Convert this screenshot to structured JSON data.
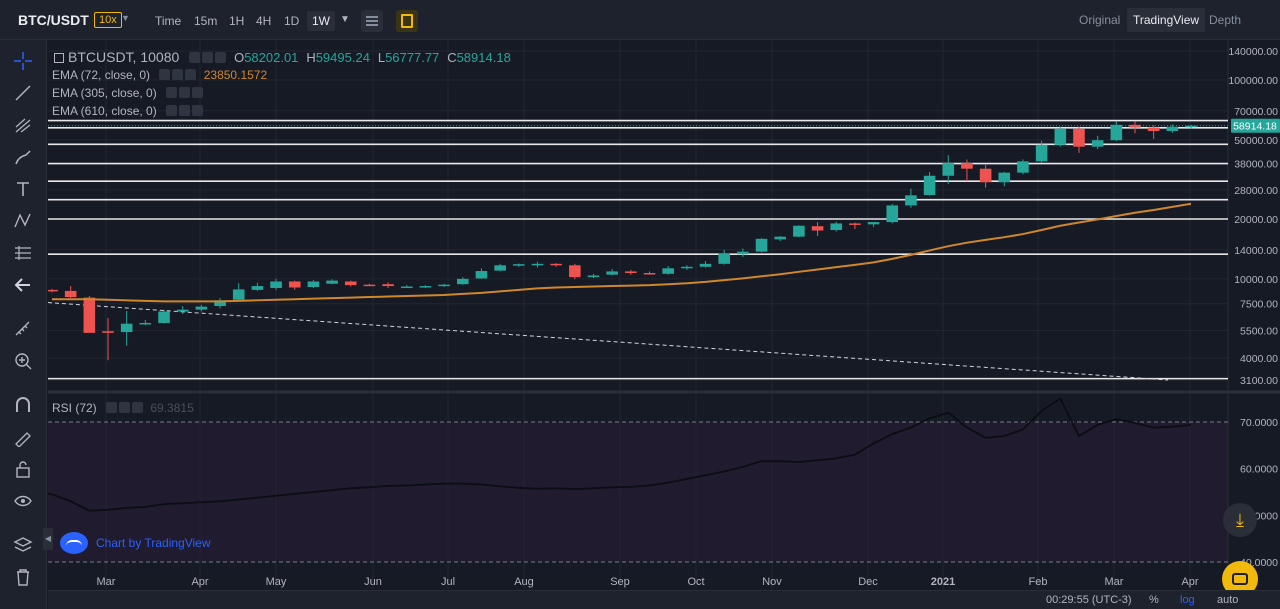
{
  "header": {
    "pair": "BTC/USDT",
    "leverage": "10x",
    "timeframes": [
      {
        "label": "Time",
        "x": 0
      },
      {
        "label": "15m"
      },
      {
        "label": "1H"
      },
      {
        "label": "4H"
      },
      {
        "label": "1D"
      },
      {
        "label": "1W"
      }
    ],
    "views": [
      "Original",
      "TradingView",
      "Depth"
    ]
  },
  "legend": {
    "symbol": "BTCUSDT, 10080",
    "o_label": "O",
    "open": "58202.01",
    "h_label": "H",
    "high": "59495.24",
    "l_label": "L",
    "low": "56777.77",
    "c_label": "C",
    "close": "58914.18",
    "ema1": "EMA (72, close, 0)",
    "ema1_value": "23850.1572",
    "ema2": "EMA (305, close, 0)",
    "ema3": "EMA (610, close, 0)",
    "rsi": "RSI (72)",
    "rsi_value": "69.3815"
  },
  "watermark": "Chart by TradingView",
  "footer": {
    "time": "00:29:55 (UTC-3)",
    "percent": "%",
    "log": "log",
    "auto": "auto"
  },
  "icons": [
    "crosshair-icon",
    "trend-line-icon",
    "pitchfork-icon",
    "brush-icon",
    "text-icon",
    "pattern-icon",
    "measure-icon",
    "back-arrow-icon",
    "ruler-icon",
    "zoom-icon",
    "magnet-icon",
    "lock-drawing-icon",
    "lock-icon",
    "eye-icon",
    "layers-icon",
    "trash-icon"
  ],
  "colors": {
    "up": "#26a69a",
    "down": "#ef5350",
    "ema": "#d0862b",
    "accent": "#f0b90b",
    "link": "#2962ff"
  },
  "chart_data": {
    "type": "candlestick",
    "price_axis": {
      "scale": "log",
      "ticks": [
        "140000.00",
        "100000.00",
        "70000.00",
        "50000.00",
        "38000.00",
        "28000.00",
        "20000.00",
        "14000.00",
        "10000.00",
        "7500.00",
        "5500.00",
        "4000.00",
        "3100.00"
      ],
      "last_price_label": "58914.18"
    },
    "time_axis": {
      "ticks": [
        "Mar",
        "Apr",
        "May",
        "Jun",
        "Jul",
        "Aug",
        "Sep",
        "Oct",
        "Nov",
        "Dec",
        "2021",
        "Feb",
        "Mar",
        "Apr"
      ]
    },
    "horizontal_levels": [
      62500,
      57500,
      47500,
      38000,
      31000,
      25000,
      20000,
      13300,
      3150
    ],
    "candles": [
      {
        "o": 8800,
        "h": 8900,
        "l": 8550,
        "c": 8750
      },
      {
        "o": 8700,
        "h": 9200,
        "l": 8000,
        "c": 8100
      },
      {
        "o": 8050,
        "h": 8200,
        "l": 5600,
        "c": 5350
      },
      {
        "o": 5450,
        "h": 6350,
        "l": 3900,
        "c": 5350
      },
      {
        "o": 5400,
        "h": 6900,
        "l": 4600,
        "c": 5950
      },
      {
        "o": 5900,
        "h": 6200,
        "l": 5850,
        "c": 6000
      },
      {
        "o": 6000,
        "h": 7000,
        "l": 5950,
        "c": 6850
      },
      {
        "o": 6850,
        "h": 7300,
        "l": 6650,
        "c": 7000
      },
      {
        "o": 7000,
        "h": 7400,
        "l": 6850,
        "c": 7250
      },
      {
        "o": 7300,
        "h": 8000,
        "l": 7100,
        "c": 7800
      },
      {
        "o": 7850,
        "h": 9500,
        "l": 7750,
        "c": 8850
      },
      {
        "o": 8800,
        "h": 9550,
        "l": 8700,
        "c": 9200
      },
      {
        "o": 9000,
        "h": 10000,
        "l": 8800,
        "c": 9700
      },
      {
        "o": 9700,
        "h": 9800,
        "l": 8800,
        "c": 9050
      },
      {
        "o": 9100,
        "h": 9850,
        "l": 9000,
        "c": 9700
      },
      {
        "o": 9450,
        "h": 9950,
        "l": 9400,
        "c": 9800
      },
      {
        "o": 9700,
        "h": 9800,
        "l": 9150,
        "c": 9300
      },
      {
        "o": 9350,
        "h": 9450,
        "l": 9200,
        "c": 9250
      },
      {
        "o": 9400,
        "h": 9600,
        "l": 9000,
        "c": 9200
      },
      {
        "o": 9150,
        "h": 9300,
        "l": 9050,
        "c": 9150
      },
      {
        "o": 9100,
        "h": 9300,
        "l": 9000,
        "c": 9200
      },
      {
        "o": 9200,
        "h": 9450,
        "l": 9100,
        "c": 9350
      },
      {
        "o": 9400,
        "h": 10200,
        "l": 9350,
        "c": 10000
      },
      {
        "o": 10050,
        "h": 11300,
        "l": 10000,
        "c": 10950
      },
      {
        "o": 11000,
        "h": 11900,
        "l": 10900,
        "c": 11700
      },
      {
        "o": 11700,
        "h": 11950,
        "l": 11500,
        "c": 11850
      },
      {
        "o": 11800,
        "h": 12200,
        "l": 11400,
        "c": 11900
      },
      {
        "o": 11900,
        "h": 12000,
        "l": 11500,
        "c": 11700
      },
      {
        "o": 11700,
        "h": 11900,
        "l": 9950,
        "c": 10200
      },
      {
        "o": 10200,
        "h": 10600,
        "l": 10100,
        "c": 10400
      },
      {
        "o": 10500,
        "h": 11200,
        "l": 10400,
        "c": 10900
      },
      {
        "o": 10900,
        "h": 11100,
        "l": 10500,
        "c": 10700
      },
      {
        "o": 10700,
        "h": 10900,
        "l": 10500,
        "c": 10600
      },
      {
        "o": 10600,
        "h": 11600,
        "l": 10500,
        "c": 11300
      },
      {
        "o": 11300,
        "h": 11700,
        "l": 11100,
        "c": 11500
      },
      {
        "o": 11500,
        "h": 12300,
        "l": 11400,
        "c": 11900
      },
      {
        "o": 11900,
        "h": 14000,
        "l": 11800,
        "c": 13400
      },
      {
        "o": 13300,
        "h": 14200,
        "l": 12900,
        "c": 13700
      },
      {
        "o": 13700,
        "h": 16000,
        "l": 13600,
        "c": 15900
      },
      {
        "o": 15800,
        "h": 16400,
        "l": 15500,
        "c": 16300
      },
      {
        "o": 16300,
        "h": 18600,
        "l": 16200,
        "c": 18500
      },
      {
        "o": 18400,
        "h": 19300,
        "l": 16400,
        "c": 17500
      },
      {
        "o": 17600,
        "h": 19400,
        "l": 17300,
        "c": 19000
      },
      {
        "o": 19000,
        "h": 19200,
        "l": 17800,
        "c": 18800
      },
      {
        "o": 18800,
        "h": 19100,
        "l": 18200,
        "c": 19300
      },
      {
        "o": 19300,
        "h": 23800,
        "l": 19000,
        "c": 23400
      },
      {
        "o": 23400,
        "h": 28400,
        "l": 22800,
        "c": 26300
      },
      {
        "o": 26400,
        "h": 34500,
        "l": 26200,
        "c": 33000
      },
      {
        "o": 33000,
        "h": 41800,
        "l": 30000,
        "c": 38200
      },
      {
        "o": 38200,
        "h": 39800,
        "l": 31000,
        "c": 35800
      },
      {
        "o": 35800,
        "h": 37400,
        "l": 28800,
        "c": 30600
      },
      {
        "o": 30600,
        "h": 34500,
        "l": 29200,
        "c": 34200
      },
      {
        "o": 34200,
        "h": 39900,
        "l": 33500,
        "c": 39000
      },
      {
        "o": 39000,
        "h": 49500,
        "l": 38500,
        "c": 47200
      },
      {
        "o": 47200,
        "h": 58300,
        "l": 46200,
        "c": 56800
      },
      {
        "o": 56800,
        "h": 58300,
        "l": 43000,
        "c": 46200
      },
      {
        "o": 46200,
        "h": 52400,
        "l": 44900,
        "c": 49800
      },
      {
        "o": 49800,
        "h": 61800,
        "l": 49200,
        "c": 59500
      },
      {
        "o": 59500,
        "h": 61700,
        "l": 53900,
        "c": 57700
      },
      {
        "o": 57700,
        "h": 59200,
        "l": 50500,
        "c": 55400
      },
      {
        "o": 55400,
        "h": 59800,
        "l": 54100,
        "c": 58200
      },
      {
        "o": 58202.01,
        "h": 59495.24,
        "l": 56777.77,
        "c": 58914.18
      }
    ],
    "ema72": [
      7900,
      7900,
      7900,
      7850,
      7800,
      7750,
      7700,
      7700,
      7700,
      7700,
      7750,
      7800,
      7850,
      7900,
      7950,
      8000,
      8050,
      8100,
      8150,
      8200,
      8250,
      8300,
      8400,
      8500,
      8650,
      8800,
      8950,
      9050,
      9100,
      9150,
      9200,
      9250,
      9300,
      9400,
      9500,
      9650,
      9850,
      10050,
      10300,
      10550,
      10850,
      11150,
      11450,
      11750,
      12100,
      12600,
      13200,
      13900,
      14600,
      15200,
      15700,
      16200,
      16800,
      17600,
      18500,
      19200,
      19900,
      20700,
      21500,
      22200,
      23000,
      23850.1572
    ],
    "dashed_trend": {
      "from": 7600,
      "to": 3100
    },
    "rsi": {
      "ticks": [
        "70.0000",
        "60.0000",
        "50.0000",
        "40.0000"
      ],
      "overbought": 70,
      "oversold": 40,
      "values": [
        54.8,
        54.5,
        53.0,
        51.0,
        51.2,
        51.6,
        51.8,
        52.4,
        52.6,
        52.8,
        53.0,
        53.4,
        53.8,
        54.2,
        54.6,
        55.0,
        55.4,
        55.8,
        56.0,
        56.3,
        56.4,
        56.6,
        56.8,
        56.8,
        56.6,
        56.2,
        55.9,
        55.7,
        55.8,
        55.6,
        55.8,
        56.0,
        56.1,
        56.4,
        57.0,
        57.8,
        58.6,
        59.4,
        60.4,
        61.6,
        61.6,
        61.4,
        61.8,
        62.2,
        63.0,
        65.4,
        67.4,
        68.8,
        70.8,
        72.0,
        68.8,
        66.6,
        67.0,
        68.4,
        72.4,
        75.0,
        67.0,
        69.4,
        70.6,
        69.8,
        68.8,
        69.0,
        69.38
      ]
    }
  }
}
